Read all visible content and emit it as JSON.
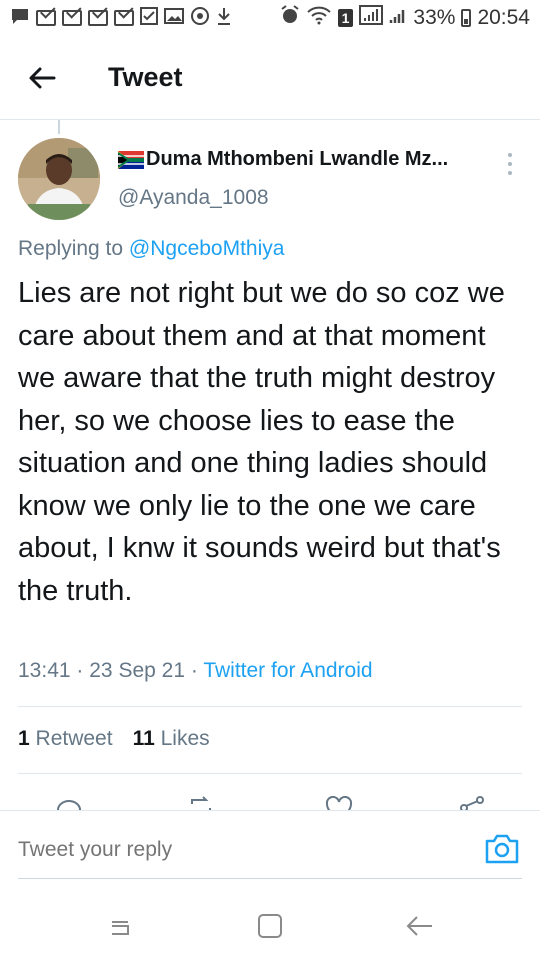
{
  "status_bar": {
    "battery": "33%",
    "time": "20:54",
    "notification_badge": "1"
  },
  "header": {
    "title": "Tweet",
    "back_icon": "arrow-left-icon"
  },
  "tweet": {
    "display_name": "Duma Mthombeni Lwandle Mz...",
    "handle": "@Ayanda_1008",
    "replying_prefix": "Replying to",
    "replying_to": "@NgceboMthiya",
    "text": "Lies are not right but we do so coz we care about them and at that moment we aware that the truth might destroy her, so we choose lies to ease the situation and one thing ladies should know we only lie to the one we care about, I knw it sounds weird but that's the truth.",
    "time": "13:41",
    "date": "23 Sep 21",
    "separator": "·",
    "source": "Twitter for Android",
    "retweet_count": "1",
    "retweet_label": "Retweet",
    "likes_count": "11",
    "likes_label": "Likes"
  },
  "reply_bar": {
    "placeholder": "Tweet your reply",
    "camera_icon": "camera-icon"
  },
  "colors": {
    "accent": "#1da1f2",
    "secondary_text": "#657786",
    "primary_text": "#14171a",
    "divider": "#e1e8ed"
  }
}
